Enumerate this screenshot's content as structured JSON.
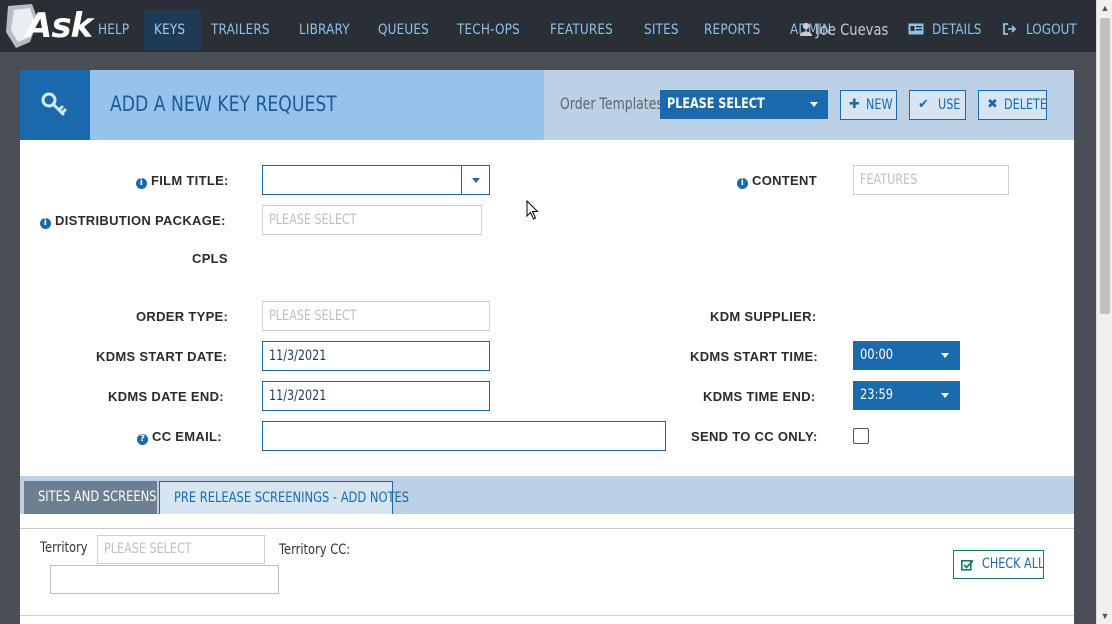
{
  "nav": {
    "items": [
      "HELP",
      "KEYS",
      "TRAILERS",
      "LIBRARY",
      "QUEUES",
      "TECH-OPS",
      "FEATURES",
      "SITES",
      "REPORTS",
      "ADMIN"
    ],
    "active_index": 1,
    "user_name": "Joe Cuevas",
    "details_label": "DETAILS",
    "logout_label": "LOGOUT"
  },
  "header": {
    "title": "ADD A NEW KEY REQUEST",
    "order_templates_label": "Order Templates",
    "template_select_value": "PLEASE SELECT",
    "new_label": "NEW",
    "use_label": "USE",
    "delete_label": "DELETE"
  },
  "form": {
    "film_title_label": "FILM TITLE:",
    "film_title_value": "",
    "content_label": "CONTENT",
    "content_placeholder": "FEATURES",
    "distribution_package_label": "DISTRIBUTION PACKAGE:",
    "distribution_package_placeholder": "PLEASE SELECT",
    "cpls_label": "CPLS",
    "order_type_label": "ORDER TYPE:",
    "order_type_placeholder": "PLEASE SELECT",
    "kdm_supplier_label": "KDM SUPPLIER:",
    "kdms_start_date_label": "KDMS START DATE:",
    "kdms_start_date_value": "11/3/2021",
    "kdms_start_time_label": "KDMS START TIME:",
    "kdms_start_time_value": "00:00",
    "kdms_date_end_label": "KDMS DATE END:",
    "kdms_date_end_value": "11/3/2021",
    "kdms_time_end_label": "KDMS TIME END:",
    "kdms_time_end_value": "23:59",
    "cc_email_label": "CC EMAIL:",
    "cc_email_value": "",
    "send_to_cc_only_label": "SEND TO CC ONLY:",
    "send_to_cc_only_checked": false
  },
  "tabs": [
    {
      "label": "SITES AND SCREENS",
      "active": true
    },
    {
      "label": "PRE RELEASE SCREENINGS - ADD NOTES",
      "active": false
    }
  ],
  "sites": {
    "territory_label": "Territory",
    "territory_placeholder": "PLEASE SELECT",
    "territory_cc_label": "Territory CC:",
    "territory_cc_value": "",
    "check_all_label": "CHECK ALL"
  },
  "colors": {
    "navbar": "#2a2f35",
    "nav_text": "#8ec1ea",
    "accent": "#1a6aad",
    "header_band": "#bcd2e4",
    "title_box": "#96c3ec"
  }
}
